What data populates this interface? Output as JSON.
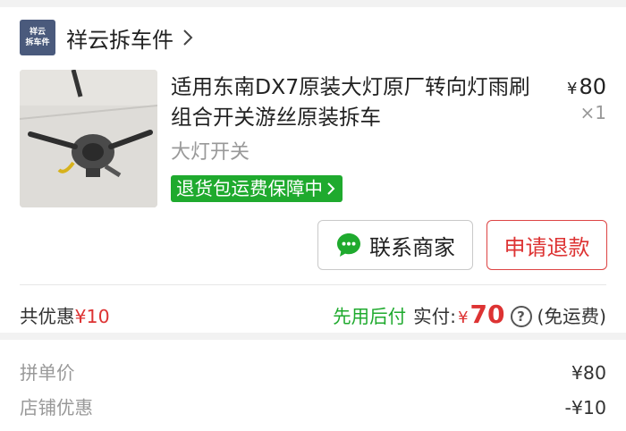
{
  "shop": {
    "logo_line1": "祥云",
    "logo_line2": "拆车件",
    "name": "祥云拆车件"
  },
  "item": {
    "title": "适用东南DX7原装大灯原厂转向灯雨刷组合开关游丝原装拆车",
    "currency": "¥",
    "price": "80",
    "quantity": "×1",
    "spec": "大灯开关",
    "badge": "退货包运费保障中"
  },
  "actions": {
    "contact_label": "联系商家",
    "refund_label": "申请退款"
  },
  "summary": {
    "discount_label": "共优惠",
    "discount_value": "¥10",
    "pay_later": "先用后付",
    "paid_label": "实付:",
    "paid_currency": "¥",
    "paid_amount": "70",
    "help_symbol": "?",
    "shipping_note": "(免运费)"
  },
  "details": [
    {
      "label": "拼单价",
      "value": "¥80"
    },
    {
      "label": "店铺优惠",
      "value": "-¥10"
    }
  ],
  "colors": {
    "accent_red": "#dd3333",
    "accent_green": "#1faa2e",
    "shop_logo_bg": "#4a5a7c"
  },
  "icons": {
    "shop_arrow": "chevron-right-icon",
    "badge_arrow": "chevron-right-icon",
    "contact": "chat-bubble-icon",
    "help": "question-circle-icon"
  }
}
